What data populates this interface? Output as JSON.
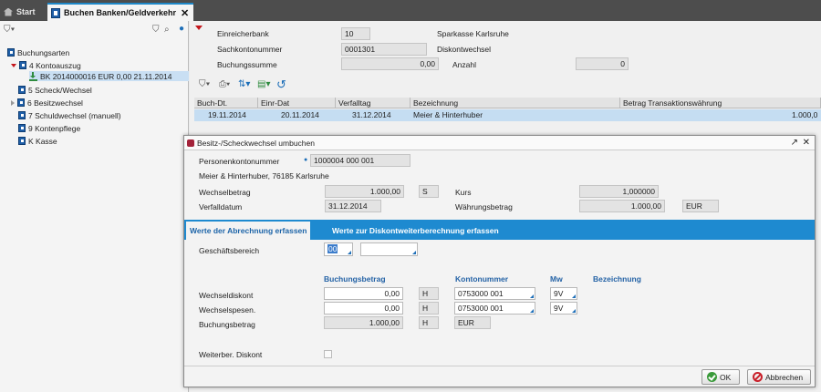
{
  "tabs": {
    "start": "Start",
    "buchen": "Buchen Banken/Geldverkehr"
  },
  "tree": {
    "root": "Buchungsarten",
    "kontoauszug": "4  Kontoauszug",
    "bk_entry": "BK  2014000016  EUR  0,00  21.11.2014",
    "scheck": "5  Scheck/Wechsel",
    "besitzwechsel": "6  Besitzwechsel",
    "schuldwechsel": "7  Schuldwechsel (manuell)",
    "kontenpflege": "9  Kontenpflege",
    "kasse": "K  Kasse"
  },
  "header": {
    "einreicherbank_label": "Einreicherbank",
    "einreicherbank_value": "10",
    "einreicherbank_name": "Sparkasse Karlsruhe",
    "sachkonto_label": "Sachkontonummer",
    "sachkonto_value": "0001301",
    "sachkonto_name": "Diskontwechsel",
    "summe_label": "Buchungssumme",
    "summe_value": "0,00",
    "anzahl_label": "Anzahl",
    "anzahl_value": "0"
  },
  "grid": {
    "columns": [
      "Buch-Dt.",
      "Einr-Dat",
      "Verfalltag",
      "Bezeichnung",
      "Betrag Transaktionswährung"
    ],
    "row": [
      "19.11.2014",
      "20.11.2014",
      "31.12.2014",
      "Meier & Hinterhuber",
      "1.000,0"
    ]
  },
  "dialog": {
    "title": "Besitz-/Scheckwechsel umbuchen",
    "personenkonto_label": "Personenkontonummer",
    "personenkonto_value": "1000004 000 001",
    "address": "Meier & Hinterhuber, 76185 Karlsruhe",
    "wechselbetrag_label": "Wechselbetrag",
    "wechselbetrag_value": "1.000,00",
    "wechselbetrag_sh": "S",
    "kurs_label": "Kurs",
    "kurs_value": "1,000000",
    "verfalldatum_label": "Verfalldatum",
    "verfalldatum_value": "31.12.2014",
    "waehrungsbetrag_label": "Währungsbetrag",
    "waehrungsbetrag_value": "1.000,00",
    "waehrung": "EUR",
    "tab_active": "Werte der Abrechnung erfassen",
    "tab_inactive": "Werte zur Diskontweiterberechnung erfassen",
    "geschaeftsbereich_label": "Geschäftsbereich",
    "geschaeftsbereich_value": "00",
    "col_buchungsbetrag": "Buchungsbetrag",
    "col_kontonummer": "Kontonummer",
    "col_mw": "Mw",
    "col_bezeichnung": "Bezeichnung",
    "rows": [
      {
        "label": "Wechseldiskont",
        "betrag": "0,00",
        "sh": "H",
        "konto": "0753000 001",
        "mw": "9V"
      },
      {
        "label": "Wechselspesen.",
        "betrag": "0,00",
        "sh": "H",
        "konto": "0753000 001",
        "mw": "9V"
      },
      {
        "label": "Buchungsbetrag",
        "betrag": "1.000,00",
        "sh": "H",
        "konto": "EUR"
      }
    ],
    "weiterber_label": "Weiterber. Diskont",
    "ok": "OK",
    "abbrechen": "Abbrechen"
  }
}
